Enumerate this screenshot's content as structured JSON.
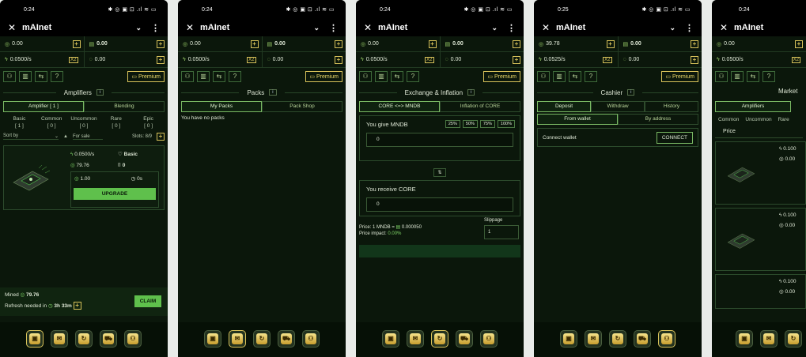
{
  "time": [
    "0:24",
    "0:24",
    "0:24",
    "0:25",
    "0:24"
  ],
  "app_title": "mAInet",
  "balances": [
    {
      "a": "0.00",
      "b": "0.00",
      "rate": "0.0500/s",
      "c": "0.00"
    },
    {
      "a": "0.00",
      "b": "0.00",
      "rate": "0.0500/s",
      "c": "0.00"
    },
    {
      "a": "0.00",
      "b": "0.00",
      "rate": "0.0500/s",
      "c": "0.00"
    },
    {
      "a": "39.78",
      "b": "0.00",
      "rate": "0.0525/s",
      "c": "0.00"
    },
    {
      "a": "0.00",
      "b": "",
      "rate": "0.0500/s",
      "c": ""
    }
  ],
  "premium": "Premium",
  "x2": "X2",
  "s1": {
    "title": "Amplifiers",
    "tab1": "Amplifier [ 1 ]",
    "tab2": "Blending",
    "rarities": [
      {
        "n": "Basic",
        "c": "[ 1 ]"
      },
      {
        "n": "Common",
        "c": "[ 0 ]"
      },
      {
        "n": "Uncommon",
        "c": "[ 0 ]"
      },
      {
        "n": "Rare",
        "c": "[ 0 ]"
      },
      {
        "n": "Epic",
        "c": "[ 0 ]"
      }
    ],
    "sort": "Sort by",
    "forsale": "For sale",
    "slots": "Slots: 8/9",
    "rate": "0.0500/s",
    "rarity": "Basic",
    "v1": "79.76",
    "v2": "0",
    "v3": "1.00",
    "v4": "0s",
    "upgrade": "UPGRADE",
    "mined_label": "Mined",
    "mined": "79.76",
    "refresh": "Refresh needed in",
    "refresh_time": "3h 33m",
    "claim": "CLAIM"
  },
  "s2": {
    "title": "Packs",
    "tab1": "My Packs",
    "tab2": "Pack Shop",
    "empty": "You have no packs"
  },
  "s3": {
    "title": "Exchange & Inflation",
    "tab1": "CORE <=> MNDB",
    "tab2": "Inflation of CORE",
    "give": "You give MNDB",
    "pcts": [
      "25%",
      "50%",
      "75%",
      "100%"
    ],
    "give_val": "0",
    "receive": "You receive CORE",
    "recv_val": "0",
    "slippage": "Slippage",
    "slip_val": "1",
    "price": "Price: 1 MNDB =",
    "price_val": "0.000050",
    "impact": "Price impact:",
    "impact_val": "0.00%"
  },
  "s4": {
    "title": "Cashier",
    "tabs": [
      "Deposit",
      "Withdraw",
      "History"
    ],
    "sub1": "From wallet",
    "sub2": "By address",
    "connect_label": "Connect wallet",
    "connect": "CONNECT"
  },
  "s5": {
    "title": "Market",
    "tab1": "Amplifiers",
    "r1": "Common",
    "r2": "Uncommon",
    "r3": "Rare",
    "price": "Price",
    "items": [
      {
        "rate": "0.100",
        "v": "0.00"
      },
      {
        "rate": "0.100",
        "v": "0.00"
      },
      {
        "rate": "0.100",
        "v": "0.00"
      }
    ]
  },
  "colors": {
    "bg": "#0b170b",
    "accent": "#5fc04c",
    "gold": "#d8c25a"
  }
}
